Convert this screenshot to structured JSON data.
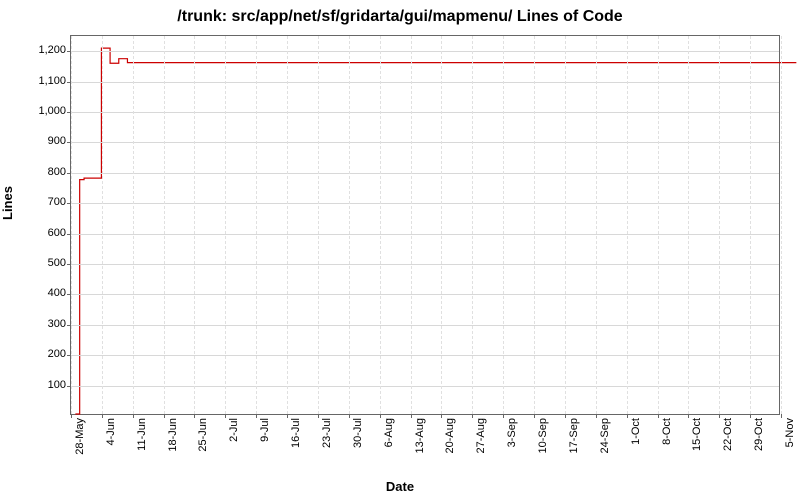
{
  "chart_data": {
    "type": "line",
    "title": "/trunk: src/app/net/sf/gridarta/gui/mapmenu/ Lines of Code",
    "xlabel": "Date",
    "ylabel": "Lines",
    "ylim": [
      0,
      1250
    ],
    "x_tick_labels": [
      "28-May",
      "4-Jun",
      "11-Jun",
      "18-Jun",
      "25-Jun",
      "2-Jul",
      "9-Jul",
      "16-Jul",
      "23-Jul",
      "30-Jul",
      "6-Aug",
      "13-Aug",
      "20-Aug",
      "27-Aug",
      "3-Sep",
      "10-Sep",
      "17-Sep",
      "24-Sep",
      "1-Oct",
      "8-Oct",
      "15-Oct",
      "22-Oct",
      "29-Oct",
      "5-Nov"
    ],
    "y_ticks": [
      100,
      200,
      300,
      400,
      500,
      600,
      700,
      800,
      900,
      1000,
      1100,
      1200
    ],
    "y_tick_labels": [
      "100",
      "200",
      "300",
      "400",
      "500",
      "600",
      "700",
      "800",
      "900",
      "1,000",
      "1,100",
      "1,200"
    ],
    "series": [
      {
        "name": "lines-of-code",
        "x": [
          "29-May",
          "30-May",
          "31-May",
          "3-Jun",
          "4-Jun",
          "5-Jun",
          "6-Jun",
          "7-Jun",
          "8-Jun",
          "9-Jun",
          "10-Jun",
          "11-Jun",
          "9-Nov"
        ],
        "values": [
          0,
          775,
          780,
          780,
          1210,
          1210,
          1160,
          1160,
          1175,
          1175,
          1162,
          1162,
          1162
        ]
      }
    ]
  }
}
